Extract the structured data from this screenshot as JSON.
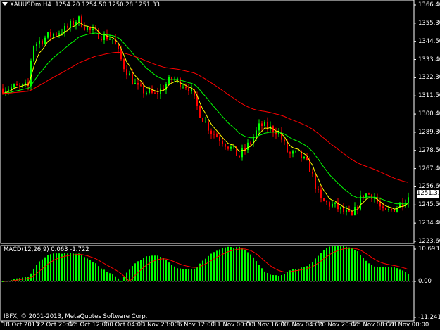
{
  "header": {
    "symbol_timeframe": "XAUUSDm,H4",
    "ohlc": "1254.20 1254.50 1250.28 1251.33"
  },
  "price_axis": {
    "labels": [
      "1366.40",
      "1355.30",
      "1344.50",
      "1333.40",
      "1322.30",
      "1311.50",
      "1300.40",
      "1289.30",
      "1278.50",
      "1267.40",
      "1256.60",
      "1245.50",
      "1234.40",
      "1223.60"
    ],
    "current_price": "1251.33"
  },
  "macd": {
    "caption": "MACD(12,26,9) 0.063 -1.722",
    "axis_labels": [
      "10.693",
      "0.00",
      "-11.241"
    ]
  },
  "time_axis": {
    "labels": [
      "18 Oct 2013",
      "22 Oct 20:00",
      "25 Oct 12:00",
      "30 Oct 04:00",
      "3 Nov 23:00",
      "6 Nov 12:00",
      "11 Nov 00:00",
      "13 Nov 16:00",
      "18 Nov 04:00",
      "20 Nov 20:00",
      "25 Nov 08:00",
      "28 Nov 00:00"
    ]
  },
  "footer": {
    "copyright": "IBFX, © 2001-2013, MetaQuotes Software Corp."
  },
  "colors": {
    "background": "#000000",
    "bull_candle": "#00ff00",
    "bear_candle": "#ff0000",
    "ma_fast": "#ffff00",
    "ma_mid": "#00ff00",
    "ma_slow": "#ff0000",
    "macd_hist": "#00ff00",
    "macd_signal": "#ff0000",
    "axis": "#ffffff"
  }
}
